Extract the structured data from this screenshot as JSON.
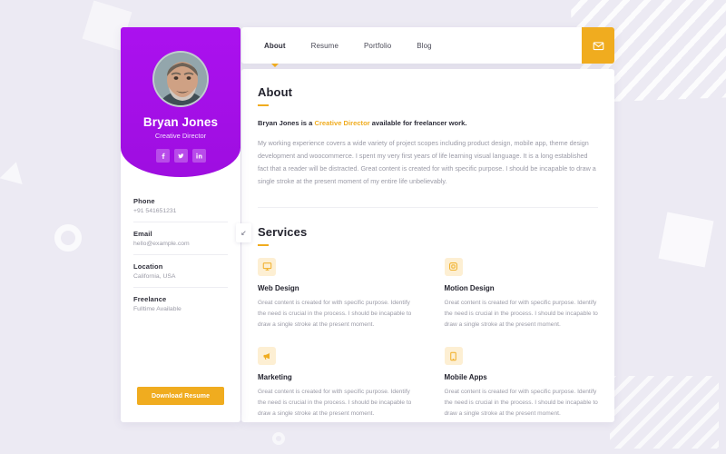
{
  "profile": {
    "name": "Bryan Jones",
    "role": "Creative Director",
    "avatar_icon": "avatar-photo",
    "socials": [
      {
        "name": "facebook-icon",
        "label": "f"
      },
      {
        "name": "twitter-icon",
        "label": "t"
      },
      {
        "name": "linkedin-icon",
        "label": "in"
      }
    ],
    "info": [
      {
        "label": "Phone",
        "value": "+91 541651231"
      },
      {
        "label": "Email",
        "value": "hello@example.com"
      },
      {
        "label": "Location",
        "value": "California, USA"
      },
      {
        "label": "Freelance",
        "value": "Fulltime Available"
      }
    ],
    "resume_button": "Download Resume"
  },
  "nav": {
    "tabs": [
      {
        "label": "About",
        "active": true
      },
      {
        "label": "Resume",
        "active": false
      },
      {
        "label": "Portfolio",
        "active": false
      },
      {
        "label": "Blog",
        "active": false
      }
    ],
    "mail_icon": "envelope-icon"
  },
  "about": {
    "title": "About",
    "lead_before": "Bryan Jones is a ",
    "lead_highlight": "Creative Director",
    "lead_after": " available for freelancer work.",
    "paragraph": "My working experience covers a wide variety of project scopes including product design, mobile app, theme design development and woocommerce. I spent my very first years of life learning visual language. It is a long established fact that a reader will be distracted. Great content is created for with specific purpose. I should be incapable to draw a single stroke at the present moment of my entire life unbelievably."
  },
  "services": {
    "title": "Services",
    "items": [
      {
        "icon": "monitor-icon",
        "title": "Web Design",
        "desc": "Great content is created for with specific purpose. Identify the need is crucial in the process. I should be incapable to draw a single stroke at the present moment."
      },
      {
        "icon": "motion-icon",
        "title": "Motion Design",
        "desc": "Great content is created for with specific purpose. Identify the need is crucial in the process. I should be incapable to draw a single stroke at the present moment."
      },
      {
        "icon": "megaphone-icon",
        "title": "Marketing",
        "desc": "Great content is created for with specific purpose. Identify the need is crucial in the process. I should be incapable to draw a single stroke at the present moment."
      },
      {
        "icon": "mobile-icon",
        "title": "Mobile Apps",
        "desc": "Great content is created for with specific purpose. Identify the need is crucial in the process. I should be incapable to draw a single stroke at the present moment."
      }
    ]
  },
  "colors": {
    "accent": "#f0ac1f",
    "profile_purple": "#a312e8",
    "page_background": "#eceaf3",
    "card": "#ffffff",
    "muted_text": "#9a9aa6"
  }
}
